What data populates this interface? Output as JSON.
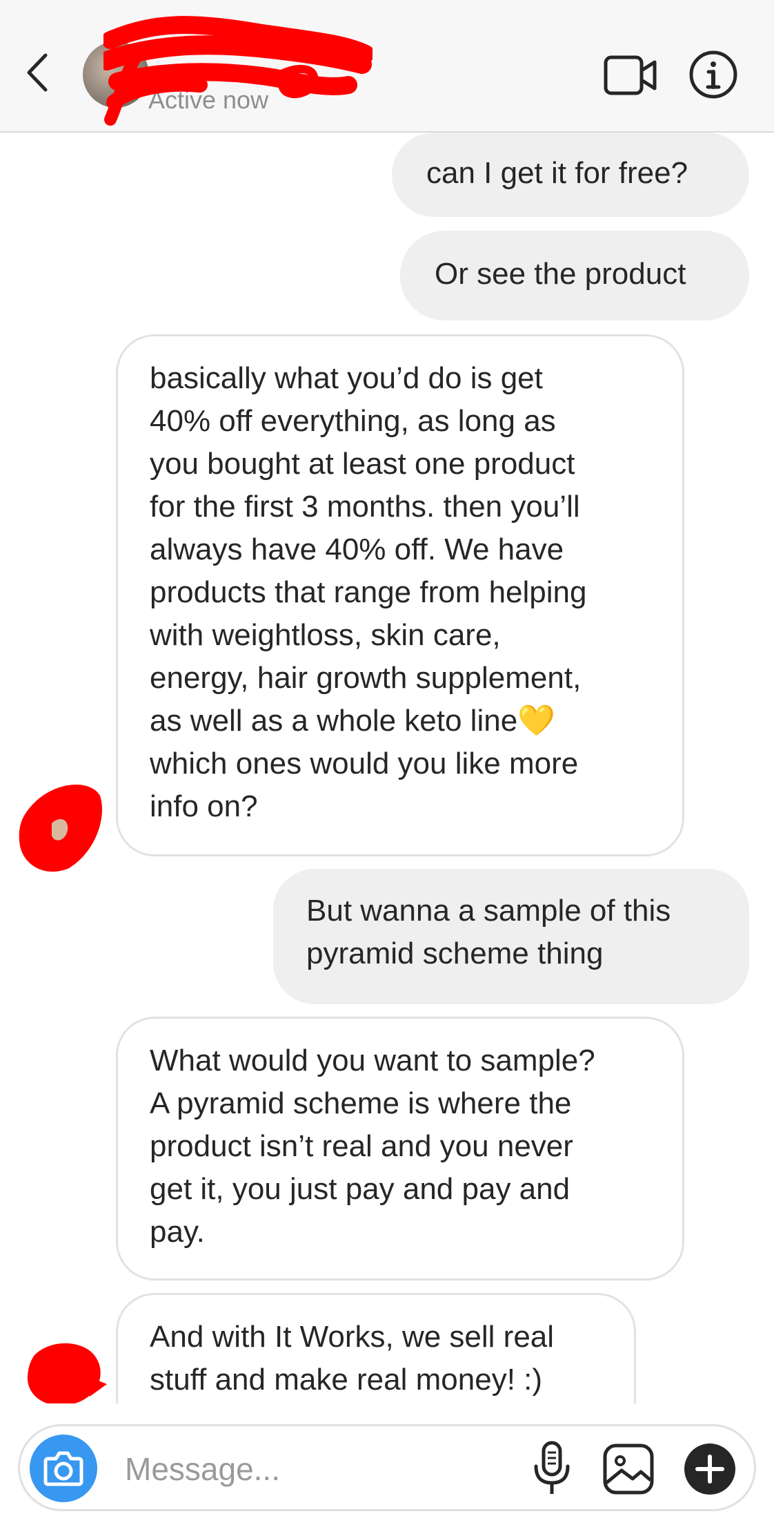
{
  "header": {
    "status": "Active now"
  },
  "messages": [
    {
      "direction": "outgoing",
      "text": "can I get it for free?"
    },
    {
      "direction": "outgoing",
      "text": "Or see the product"
    },
    {
      "direction": "incoming",
      "text": "basically what you’d do is get\n40% off everything, as long as\nyou bought at least one product\nfor the first 3 months. then you’ll\nalways have 40% off. We have\nproducts that range from helping\nwith weightloss, skin care,\nenergy, hair growth supplement,\nas well as a whole keto line💛\nwhich ones would you like more\ninfo on?"
    },
    {
      "direction": "outgoing",
      "text": "But wanna a sample of this\npyramid scheme thing"
    },
    {
      "direction": "incoming",
      "text": "What would you want to sample?\nA pyramid scheme is where the\nproduct isn’t real and you never\nget it, you just pay and pay and\npay."
    },
    {
      "direction": "incoming",
      "text": "And with It Works, we sell real\nstuff and make real money! :)"
    }
  ],
  "composer": {
    "placeholder": "Message..."
  },
  "colors": {
    "accent": "#3897f0",
    "redaction": "#ff0000",
    "outgoing_bubble": "#efefef",
    "incoming_border": "#e2e2e2"
  },
  "icons": [
    "back-chevron-icon",
    "video-camera-icon",
    "info-icon",
    "camera-icon",
    "microphone-icon",
    "gallery-icon",
    "plus-icon"
  ]
}
